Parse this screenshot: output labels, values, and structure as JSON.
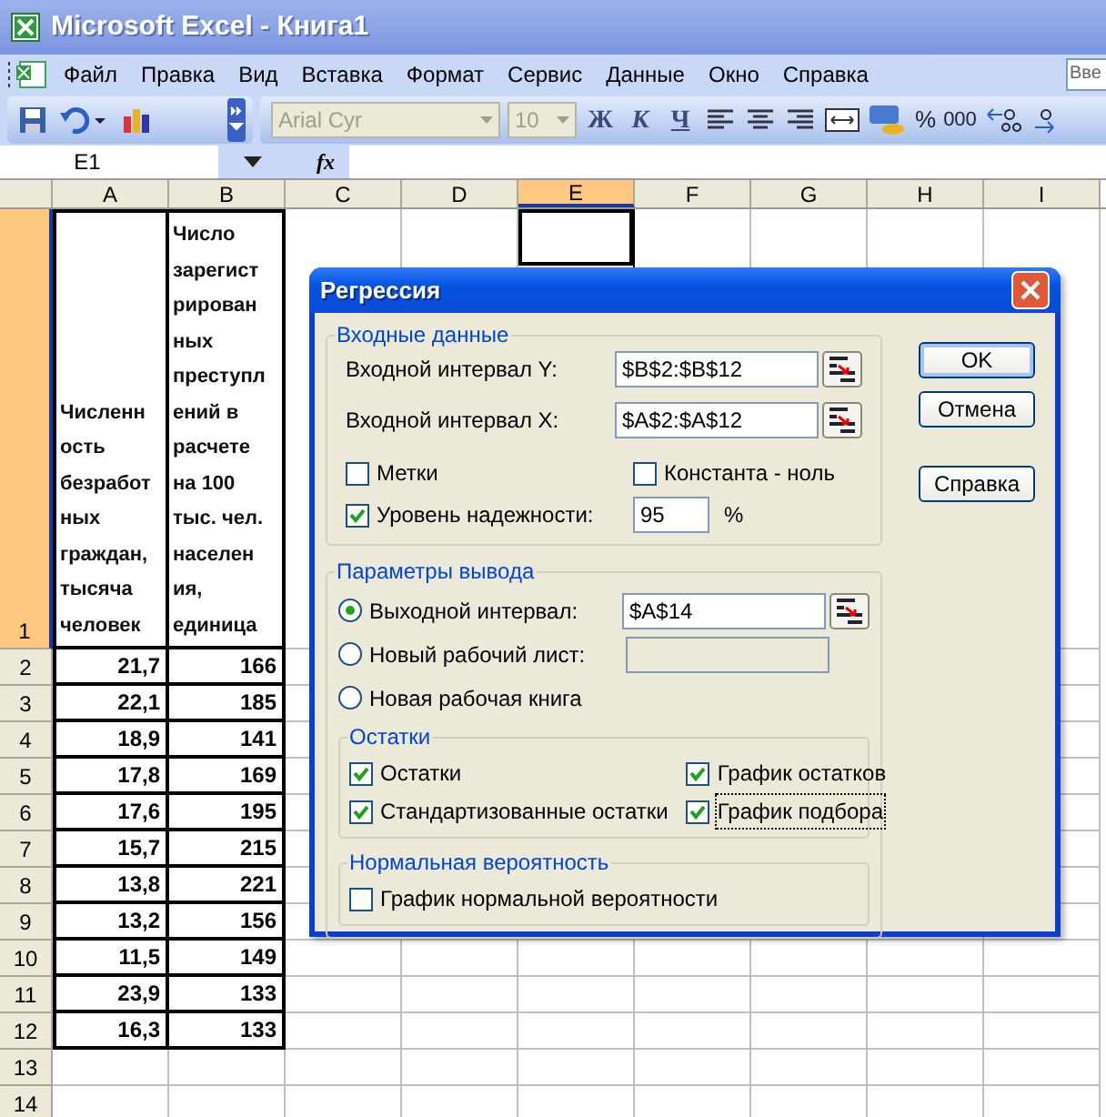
{
  "window": {
    "title": "Microsoft Excel - Книга1"
  },
  "menu": {
    "items": [
      "Файл",
      "Правка",
      "Вид",
      "Вставка",
      "Формат",
      "Сервис",
      "Данные",
      "Окно",
      "Справка"
    ],
    "help_box": "Вве"
  },
  "toolbar": {
    "font": "Arial Cyr",
    "size": "10",
    "bold": "Ж",
    "italic": "К",
    "underline": "Ч",
    "percent": "%",
    "thousands": "000"
  },
  "formula_bar": {
    "name_box": "E1",
    "fx": "fx"
  },
  "columns": [
    {
      "label": "A",
      "selected": false
    },
    {
      "label": "B",
      "selected": false
    },
    {
      "label": "C",
      "selected": false
    },
    {
      "label": "D",
      "selected": false
    },
    {
      "label": "E",
      "selected": true
    },
    {
      "label": "F",
      "selected": false
    },
    {
      "label": "G",
      "selected": false
    },
    {
      "label": "H",
      "selected": false
    },
    {
      "label": "I",
      "selected": false
    }
  ],
  "header_row": {
    "label": "1",
    "selected": true,
    "cells": [
      {
        "lines": [
          "Численн",
          "ость",
          "безработ",
          "ных",
          "граждан,",
          "тысяча",
          "человек"
        ]
      },
      {
        "lines": [
          "Число",
          "зарегист",
          "рирован",
          "ных",
          "преступл",
          "ений в",
          "расчете",
          "на 100",
          "тыс. чел.",
          "населен",
          "ия,",
          "единица"
        ]
      }
    ]
  },
  "rows": [
    {
      "label": "2",
      "cells": [
        "21,7",
        "166"
      ]
    },
    {
      "label": "3",
      "cells": [
        "22,1",
        "185"
      ]
    },
    {
      "label": "4",
      "cells": [
        "18,9",
        "141"
      ]
    },
    {
      "label": "5",
      "cells": [
        "17,8",
        "169"
      ]
    },
    {
      "label": "6",
      "cells": [
        "17,6",
        "195"
      ]
    },
    {
      "label": "7",
      "cells": [
        "15,7",
        "215"
      ]
    },
    {
      "label": "8",
      "cells": [
        "13,8",
        "221"
      ]
    },
    {
      "label": "9",
      "cells": [
        "13,2",
        "156"
      ]
    },
    {
      "label": "10",
      "cells": [
        "11,5",
        "149"
      ]
    },
    {
      "label": "11",
      "cells": [
        "23,9",
        "133"
      ]
    },
    {
      "label": "12",
      "cells": [
        "16,3",
        "133"
      ]
    },
    {
      "label": "13",
      "cells": []
    },
    {
      "label": "14",
      "cells": []
    }
  ],
  "dialog": {
    "title": "Регрессия",
    "input": {
      "title": "Входные данные",
      "fields": [
        {
          "label": "Входной интервал Y:",
          "value": "$B$2:$B$12"
        },
        {
          "label": "Входной интервал X:",
          "value": "$A$2:$A$12"
        }
      ],
      "labels": {
        "label": "Метки",
        "checked": false
      },
      "constant_zero": {
        "label": "Константа - ноль",
        "checked": false
      },
      "confidence": {
        "label": "Уровень надежности:",
        "checked": true,
        "value": "95",
        "unit": "%"
      }
    },
    "output": {
      "title": "Параметры вывода",
      "options": [
        {
          "label": "Выходной интервал:",
          "kind": "range",
          "selected": true,
          "value": "$A$14"
        },
        {
          "label": "Новый рабочий лист:",
          "kind": "range",
          "selected": false
        },
        {
          "label": "Новая рабочая книга",
          "kind": "plain",
          "selected": false
        }
      ],
      "residuals": {
        "title": "Остатки",
        "items": [
          {
            "label": "Остатки",
            "checked": true,
            "focused": false
          },
          {
            "label": "График остатков",
            "checked": true,
            "focused": false
          },
          {
            "label": "Стандартизованные остатки",
            "checked": true,
            "focused": false
          },
          {
            "label": "График подбора",
            "checked": true,
            "focused": true
          }
        ]
      },
      "normal": {
        "title": "Нормальная вероятность",
        "items": [
          {
            "label": "График нормальной вероятности",
            "checked": false
          }
        ]
      }
    },
    "buttons": [
      "OK",
      "Отмена",
      "Справка"
    ]
  }
}
